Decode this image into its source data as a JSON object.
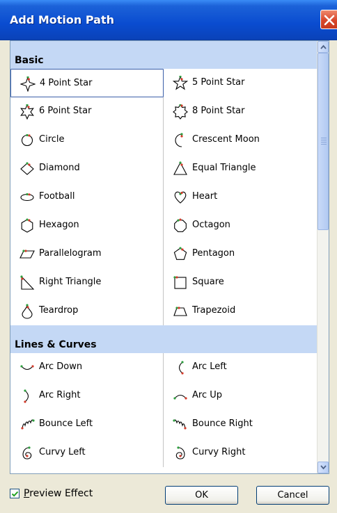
{
  "window": {
    "title": "Add Motion Path"
  },
  "groups": [
    {
      "name": "Basic",
      "items": [
        {
          "label": "4 Point Star",
          "icon": "star4-icon"
        },
        {
          "label": "5 Point Star",
          "icon": "star5-icon"
        },
        {
          "label": "6 Point Star",
          "icon": "star6-icon"
        },
        {
          "label": "8 Point Star",
          "icon": "star8-icon"
        },
        {
          "label": "Circle",
          "icon": "circle-icon"
        },
        {
          "label": "Crescent Moon",
          "icon": "crescent-moon-icon"
        },
        {
          "label": "Diamond",
          "icon": "diamond-icon"
        },
        {
          "label": "Equal Triangle",
          "icon": "equal-triangle-icon"
        },
        {
          "label": "Football",
          "icon": "football-icon"
        },
        {
          "label": "Heart",
          "icon": "heart-icon"
        },
        {
          "label": "Hexagon",
          "icon": "hexagon-icon"
        },
        {
          "label": "Octagon",
          "icon": "octagon-icon"
        },
        {
          "label": "Parallelogram",
          "icon": "parallelogram-icon"
        },
        {
          "label": "Pentagon",
          "icon": "pentagon-icon"
        },
        {
          "label": "Right Triangle",
          "icon": "right-triangle-icon"
        },
        {
          "label": "Square",
          "icon": "square-icon"
        },
        {
          "label": "Teardrop",
          "icon": "teardrop-icon"
        },
        {
          "label": "Trapezoid",
          "icon": "trapezoid-icon"
        }
      ]
    },
    {
      "name": "Lines & Curves",
      "items": [
        {
          "label": "Arc Down",
          "icon": "arc-down-icon"
        },
        {
          "label": "Arc Left",
          "icon": "arc-left-icon"
        },
        {
          "label": "Arc Right",
          "icon": "arc-right-icon"
        },
        {
          "label": "Arc Up",
          "icon": "arc-up-icon"
        },
        {
          "label": "Bounce Left",
          "icon": "bounce-left-icon"
        },
        {
          "label": "Bounce Right",
          "icon": "bounce-right-icon"
        },
        {
          "label": "Curvy Left",
          "icon": "curvy-left-icon"
        },
        {
          "label": "Curvy Right",
          "icon": "curvy-right-icon"
        }
      ]
    }
  ],
  "selected_item": "4 Point Star",
  "footer": {
    "preview_label": "Preview Effect",
    "preview_mnemonic": "P",
    "preview_checked": true,
    "ok_label": "OK",
    "cancel_label": "Cancel"
  },
  "colors": {
    "titlebar": "#0a4cd0",
    "group_header": "#c4d8f5",
    "path_stroke": "#000000",
    "start_marker": "#2e9e3e",
    "end_marker": "#d23a2a"
  }
}
